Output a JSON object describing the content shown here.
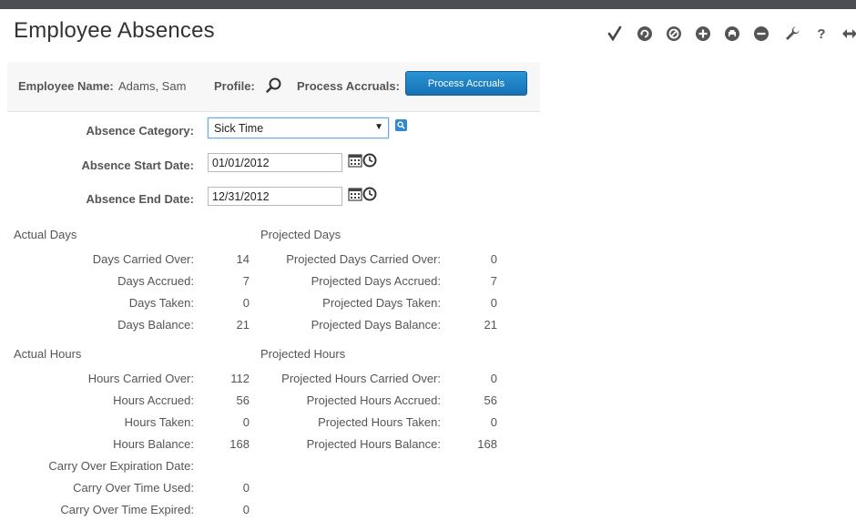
{
  "page": {
    "title": "Employee Absences"
  },
  "toolbar": [
    "check-icon",
    "refresh-icon",
    "cancel-icon",
    "add-icon",
    "print-icon",
    "remove-icon",
    "wrench-icon",
    "help-icon",
    "expand-icon"
  ],
  "employee": {
    "name_label": "Employee Name:",
    "name_value": "Adams, Sam",
    "profile_label": "Profile:",
    "process_label": "Process Accruals:",
    "process_button": "Process Accruals"
  },
  "form": {
    "category_label": "Absence Category:",
    "category_value": "Sick Time",
    "start_label": "Absence Start Date:",
    "start_value": "01/01/2012",
    "end_label": "Absence End Date:",
    "end_value": "12/31/2012"
  },
  "actual_days": {
    "title": "Actual Days",
    "rows": [
      {
        "label": "Days Carried Over:",
        "value": "14"
      },
      {
        "label": "Days Accrued:",
        "value": "7"
      },
      {
        "label": "Days Taken:",
        "value": "0"
      },
      {
        "label": "Days Balance:",
        "value": "21"
      }
    ]
  },
  "projected_days": {
    "title": "Projected Days",
    "rows": [
      {
        "label": "Projected Days Carried Over:",
        "value": "0"
      },
      {
        "label": "Projected Days Accrued:",
        "value": "7"
      },
      {
        "label": "Projected Days Taken:",
        "value": "0"
      },
      {
        "label": "Projected Days Balance:",
        "value": "21"
      }
    ]
  },
  "actual_hours": {
    "title": "Actual Hours",
    "rows": [
      {
        "label": "Hours Carried Over:",
        "value": "112"
      },
      {
        "label": "Hours Accrued:",
        "value": "56"
      },
      {
        "label": "Hours Taken:",
        "value": "0"
      },
      {
        "label": "Hours Balance:",
        "value": "168"
      },
      {
        "label": "Carry Over Expiration Date:",
        "value": ""
      },
      {
        "label": "Carry Over Time Used:",
        "value": "0"
      },
      {
        "label": "Carry Over Time Expired:",
        "value": "0"
      }
    ]
  },
  "projected_hours": {
    "title": "Projected Hours",
    "rows": [
      {
        "label": "Projected Hours Carried Over:",
        "value": "0"
      },
      {
        "label": "Projected Hours Accrued:",
        "value": "56"
      },
      {
        "label": "Projected Hours Taken:",
        "value": "0"
      },
      {
        "label": "Projected Hours Balance:",
        "value": "168"
      }
    ]
  }
}
